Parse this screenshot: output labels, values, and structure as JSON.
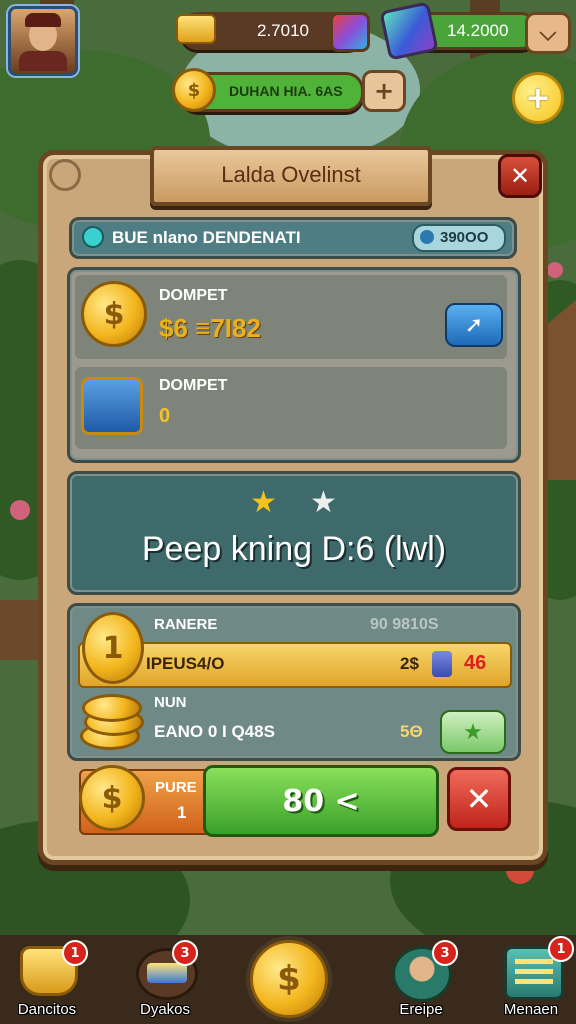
{
  "top_bar": {
    "gold_value": "2.7010",
    "gem_value": "14.2000",
    "banner_text": "DUHAN HIA. 6AS"
  },
  "dialog": {
    "title": "Lalda Ovelinst",
    "info_text": "BUE nlano DENDENATI",
    "info_value": "390OO",
    "wallet1": {
      "label": "DOMPET",
      "value": "$6 ≡7I82"
    },
    "wallet2": {
      "label": "DOMPET",
      "value": "0"
    },
    "banner": {
      "text": "Peep kning D:6 (lwl)",
      "stars_filled": 1,
      "stars_total": 2
    },
    "reward1": {
      "label": "RANERE",
      "faded_value": "90 9810S",
      "amount": "IPEUS4/O",
      "count": "2$",
      "extra": "46",
      "coin_mark": "1"
    },
    "reward2": {
      "label": "NUN",
      "amount": "EANO 0 I Q48S",
      "count": "5Θ"
    },
    "footer": {
      "label": "PURE",
      "value": "1",
      "confirm": "80 <"
    }
  },
  "nav": [
    {
      "label": "Dancitos",
      "badge": "1"
    },
    {
      "label": "Dyakos",
      "badge": "3"
    },
    {
      "label": "",
      "badge": ""
    },
    {
      "label": "Ereipe",
      "badge": "3"
    },
    {
      "label": "Menaen",
      "badge": "1"
    }
  ]
}
